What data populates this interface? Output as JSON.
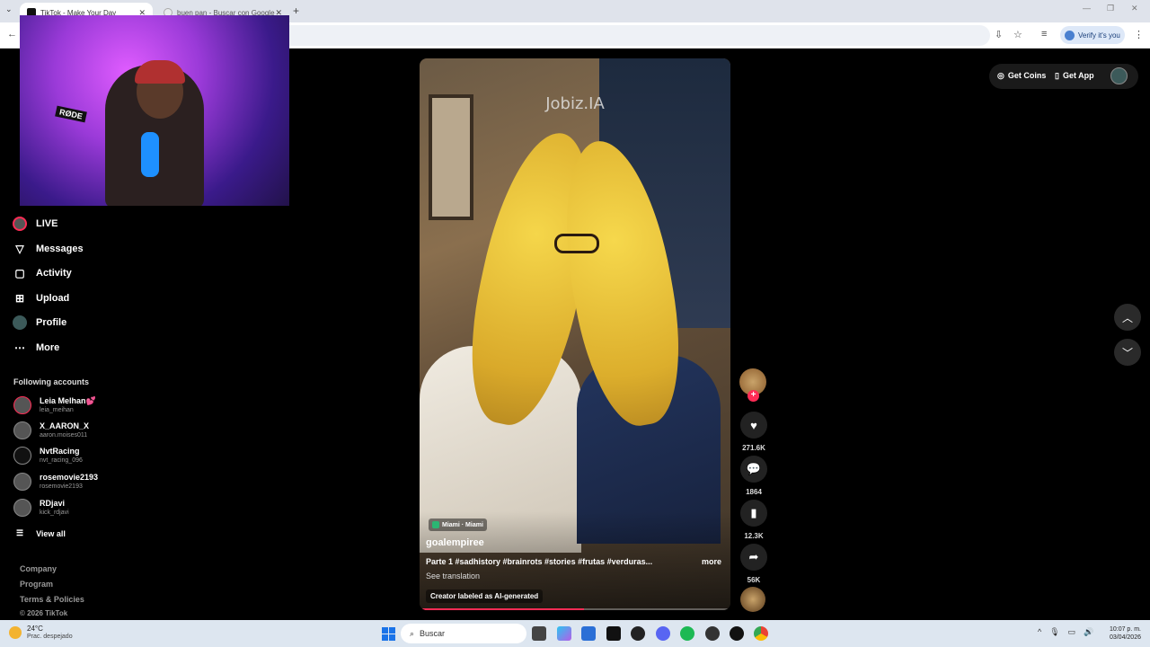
{
  "browser": {
    "tabs": [
      {
        "title": "TikTok - Make Your Day",
        "active": true
      },
      {
        "title": "buen pan - Buscar con Google",
        "active": false
      }
    ],
    "new_tab": "+",
    "verify_label": "Verify it's you"
  },
  "sidebar": {
    "items": [
      {
        "label": "LIVE",
        "icon": "live-icon"
      },
      {
        "label": "Messages",
        "icon": "messages-icon"
      },
      {
        "label": "Activity",
        "icon": "activity-icon"
      },
      {
        "label": "Upload",
        "icon": "upload-icon"
      },
      {
        "label": "Profile",
        "icon": "profile-icon"
      },
      {
        "label": "More",
        "icon": "more-icon"
      }
    ],
    "following_title": "Following accounts",
    "accounts": [
      {
        "name": "Leia Melhan💕",
        "handle": "leia_meihan"
      },
      {
        "name": "X_AARON_X",
        "handle": "aaron.moises011"
      },
      {
        "name": "NvtRacing",
        "handle": "nvt_racing_096"
      },
      {
        "name": "rosemovie2193",
        "handle": "rosemovie2193"
      },
      {
        "name": "RDjavi",
        "handle": "kick_rdjavi"
      }
    ],
    "view_all": "View all",
    "footer": [
      "Company",
      "Program",
      "Terms & Policies"
    ],
    "copyright": "© 2026 TikTok"
  },
  "video": {
    "watermark": "Jobiz.IA",
    "location": "Miami · Miami",
    "author": "goalempiree",
    "caption": "Parte 1 #sadhistory #brainrots #stories #frutas #verduras...",
    "more": "more",
    "see_translation": "See translation",
    "ai_label": "Creator labeled as AI-generated",
    "progress": 0.53
  },
  "actions": {
    "likes": "271.6K",
    "comments": "1864",
    "saves": "12.3K",
    "shares": "56K"
  },
  "topbar": {
    "get_coins": "Get Coins",
    "get_app": "Get App"
  },
  "taskbar": {
    "temp": "24°C",
    "weather": "Prac. despejado",
    "search": "Buscar",
    "time": "10:07 p. m.",
    "date": "03/04/2026"
  },
  "webcam": {
    "mic_brand": "RØDE"
  },
  "colors": {
    "accent": "#fe2c55",
    "background": "#000000"
  }
}
